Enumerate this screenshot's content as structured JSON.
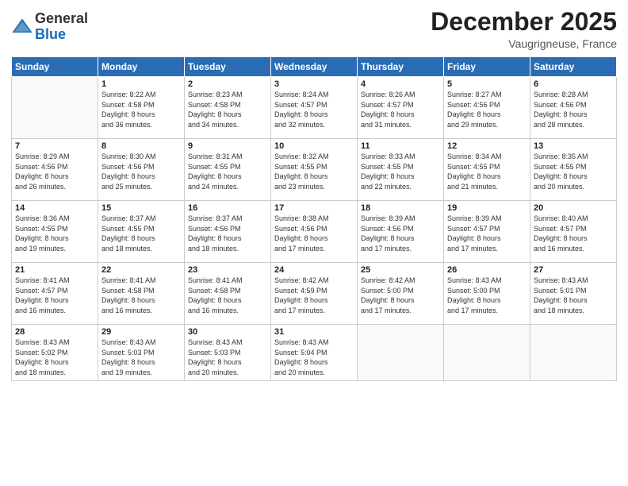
{
  "logo": {
    "general": "General",
    "blue": "Blue"
  },
  "header": {
    "month": "December 2025",
    "location": "Vaugrigneuse, France"
  },
  "weekdays": [
    "Sunday",
    "Monday",
    "Tuesday",
    "Wednesday",
    "Thursday",
    "Friday",
    "Saturday"
  ],
  "weeks": [
    [
      {
        "day": "",
        "info": ""
      },
      {
        "day": "1",
        "info": "Sunrise: 8:22 AM\nSunset: 4:58 PM\nDaylight: 8 hours\nand 36 minutes."
      },
      {
        "day": "2",
        "info": "Sunrise: 8:23 AM\nSunset: 4:58 PM\nDaylight: 8 hours\nand 34 minutes."
      },
      {
        "day": "3",
        "info": "Sunrise: 8:24 AM\nSunset: 4:57 PM\nDaylight: 8 hours\nand 32 minutes."
      },
      {
        "day": "4",
        "info": "Sunrise: 8:26 AM\nSunset: 4:57 PM\nDaylight: 8 hours\nand 31 minutes."
      },
      {
        "day": "5",
        "info": "Sunrise: 8:27 AM\nSunset: 4:56 PM\nDaylight: 8 hours\nand 29 minutes."
      },
      {
        "day": "6",
        "info": "Sunrise: 8:28 AM\nSunset: 4:56 PM\nDaylight: 8 hours\nand 28 minutes."
      }
    ],
    [
      {
        "day": "7",
        "info": "Sunrise: 8:29 AM\nSunset: 4:56 PM\nDaylight: 8 hours\nand 26 minutes."
      },
      {
        "day": "8",
        "info": "Sunrise: 8:30 AM\nSunset: 4:56 PM\nDaylight: 8 hours\nand 25 minutes."
      },
      {
        "day": "9",
        "info": "Sunrise: 8:31 AM\nSunset: 4:55 PM\nDaylight: 8 hours\nand 24 minutes."
      },
      {
        "day": "10",
        "info": "Sunrise: 8:32 AM\nSunset: 4:55 PM\nDaylight: 8 hours\nand 23 minutes."
      },
      {
        "day": "11",
        "info": "Sunrise: 8:33 AM\nSunset: 4:55 PM\nDaylight: 8 hours\nand 22 minutes."
      },
      {
        "day": "12",
        "info": "Sunrise: 8:34 AM\nSunset: 4:55 PM\nDaylight: 8 hours\nand 21 minutes."
      },
      {
        "day": "13",
        "info": "Sunrise: 8:35 AM\nSunset: 4:55 PM\nDaylight: 8 hours\nand 20 minutes."
      }
    ],
    [
      {
        "day": "14",
        "info": "Sunrise: 8:36 AM\nSunset: 4:55 PM\nDaylight: 8 hours\nand 19 minutes."
      },
      {
        "day": "15",
        "info": "Sunrise: 8:37 AM\nSunset: 4:55 PM\nDaylight: 8 hours\nand 18 minutes."
      },
      {
        "day": "16",
        "info": "Sunrise: 8:37 AM\nSunset: 4:56 PM\nDaylight: 8 hours\nand 18 minutes."
      },
      {
        "day": "17",
        "info": "Sunrise: 8:38 AM\nSunset: 4:56 PM\nDaylight: 8 hours\nand 17 minutes."
      },
      {
        "day": "18",
        "info": "Sunrise: 8:39 AM\nSunset: 4:56 PM\nDaylight: 8 hours\nand 17 minutes."
      },
      {
        "day": "19",
        "info": "Sunrise: 8:39 AM\nSunset: 4:57 PM\nDaylight: 8 hours\nand 17 minutes."
      },
      {
        "day": "20",
        "info": "Sunrise: 8:40 AM\nSunset: 4:57 PM\nDaylight: 8 hours\nand 16 minutes."
      }
    ],
    [
      {
        "day": "21",
        "info": "Sunrise: 8:41 AM\nSunset: 4:57 PM\nDaylight: 8 hours\nand 16 minutes."
      },
      {
        "day": "22",
        "info": "Sunrise: 8:41 AM\nSunset: 4:58 PM\nDaylight: 8 hours\nand 16 minutes."
      },
      {
        "day": "23",
        "info": "Sunrise: 8:41 AM\nSunset: 4:58 PM\nDaylight: 8 hours\nand 16 minutes."
      },
      {
        "day": "24",
        "info": "Sunrise: 8:42 AM\nSunset: 4:59 PM\nDaylight: 8 hours\nand 17 minutes."
      },
      {
        "day": "25",
        "info": "Sunrise: 8:42 AM\nSunset: 5:00 PM\nDaylight: 8 hours\nand 17 minutes."
      },
      {
        "day": "26",
        "info": "Sunrise: 8:43 AM\nSunset: 5:00 PM\nDaylight: 8 hours\nand 17 minutes."
      },
      {
        "day": "27",
        "info": "Sunrise: 8:43 AM\nSunset: 5:01 PM\nDaylight: 8 hours\nand 18 minutes."
      }
    ],
    [
      {
        "day": "28",
        "info": "Sunrise: 8:43 AM\nSunset: 5:02 PM\nDaylight: 8 hours\nand 18 minutes."
      },
      {
        "day": "29",
        "info": "Sunrise: 8:43 AM\nSunset: 5:03 PM\nDaylight: 8 hours\nand 19 minutes."
      },
      {
        "day": "30",
        "info": "Sunrise: 8:43 AM\nSunset: 5:03 PM\nDaylight: 8 hours\nand 20 minutes."
      },
      {
        "day": "31",
        "info": "Sunrise: 8:43 AM\nSunset: 5:04 PM\nDaylight: 8 hours\nand 20 minutes."
      },
      {
        "day": "",
        "info": ""
      },
      {
        "day": "",
        "info": ""
      },
      {
        "day": "",
        "info": ""
      }
    ]
  ]
}
